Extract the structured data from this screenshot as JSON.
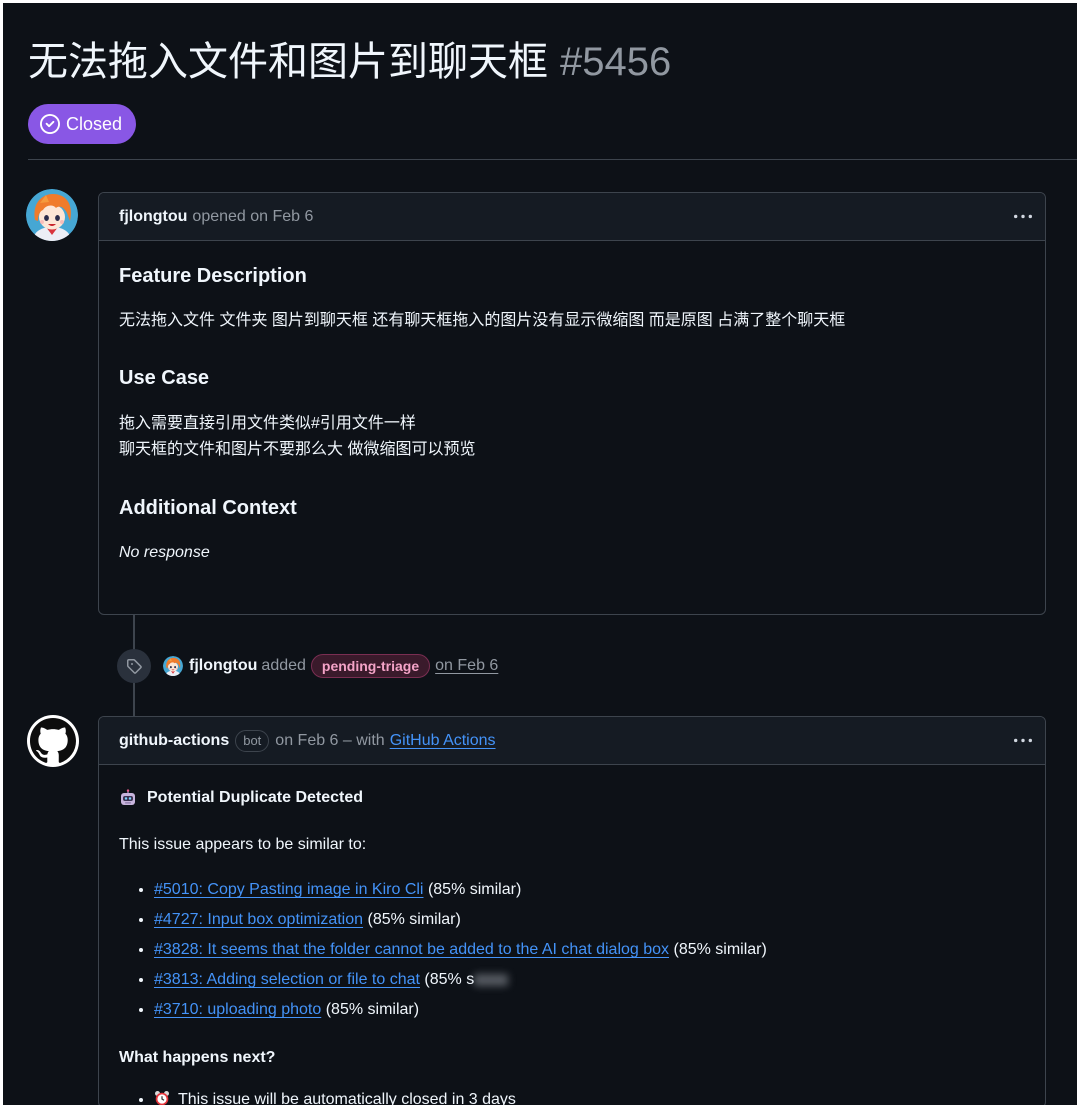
{
  "issue": {
    "title": "无法拖入文件和图片到聊天框",
    "number": "#5456",
    "state": "Closed",
    "state_icon": "issue-closed-icon"
  },
  "opening_comment": {
    "author": "fjlongtou",
    "action": "opened on Feb 6",
    "avatar": "user-avatar",
    "menu_icon": "kebab-horizontal-icon",
    "sections": [
      {
        "heading": "Feature Description",
        "lines": [
          "无法拖入文件 文件夹 图片到聊天框 还有聊天框拖入的图片没有显示微缩图 而是原图 占满了整个聊天框"
        ]
      },
      {
        "heading": "Use Case",
        "lines": [
          "拖入需要直接引用文件类似#引用文件一样",
          "聊天框的文件和图片不要那么大 做微缩图可以预览"
        ]
      },
      {
        "heading": "Additional Context",
        "lines": [
          "No response"
        ]
      }
    ]
  },
  "timeline_event": {
    "icon": "tag-icon",
    "actor": "fjlongtou",
    "action": "added",
    "label": "pending-triage",
    "time": "on Feb 6"
  },
  "bot_comment": {
    "author": "github-actions",
    "badge": "bot",
    "meta": "on Feb 6 – with",
    "app_link": "GitHub Actions",
    "avatar": "github-mark-icon",
    "menu_icon": "kebab-horizontal-icon",
    "heading_icon": "robot-icon",
    "heading": "Potential Duplicate Detected",
    "intro": "This issue appears to be similar to:",
    "similar_issues": [
      {
        "link": "#5010: Copy Pasting image in Kiro Cli",
        "score": "(85% similar)"
      },
      {
        "link": "#4727: Input box optimization",
        "score": "(85% similar)"
      },
      {
        "link": "#3828: It seems that the folder cannot be added to the AI chat dialog box",
        "score": "(85% similar)"
      },
      {
        "link": "#3813: Adding selection or file to chat",
        "score": "(85% s"
      },
      {
        "link": "#3710: uploading photo",
        "score": "(85% similar)"
      }
    ],
    "next_heading": "What happens next?",
    "next_steps": [
      {
        "icon": "alarm-clock-icon",
        "text": "This issue will be automatically closed in 3 days"
      }
    ]
  },
  "colors": {
    "background": "#0d1117",
    "text": "#f0f6fc",
    "muted": "#9198a1",
    "border": "#3d444d",
    "header_bg": "#151b23",
    "link": "#4493f8",
    "closed_badge": "#8957e5",
    "label_text": "#f4a3c7",
    "label_bg": "#3a1a2b"
  }
}
